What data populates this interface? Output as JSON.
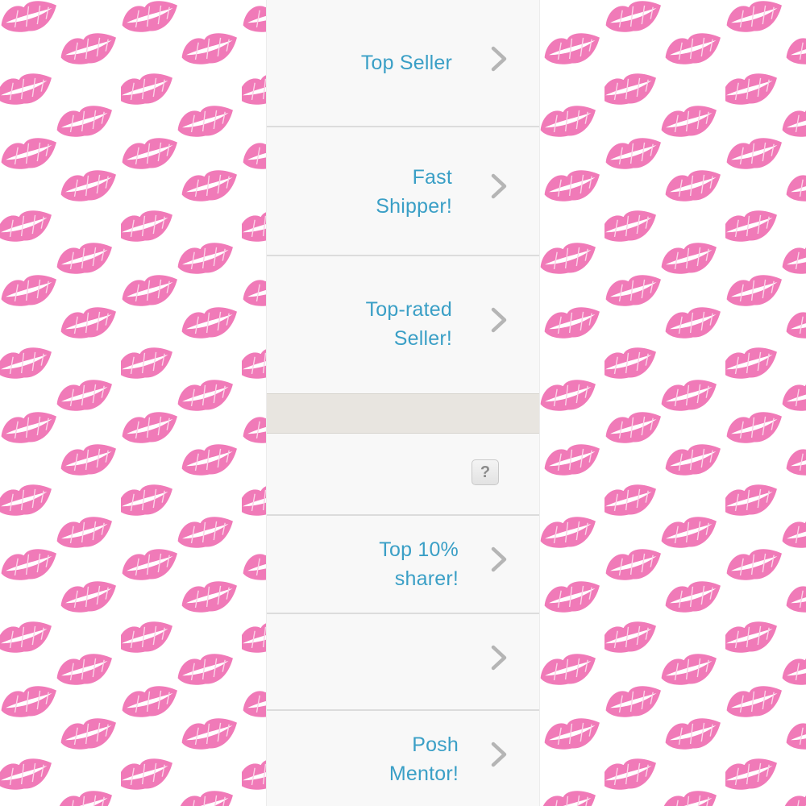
{
  "rows": [
    {
      "label": "Top Seller"
    },
    {
      "label": "Fast\nShipper!"
    },
    {
      "label": "Top-rated\nSeller!"
    },
    {
      "label": "Top 10%\nsharer!"
    },
    {
      "label": ""
    },
    {
      "label": "Posh\nMentor!"
    }
  ],
  "help_row": {
    "icon_text": "?"
  },
  "colors": {
    "link_text": "#3a9fc6",
    "lips": "#f07ab8",
    "chevron": "#b5b5b5"
  },
  "icons": {
    "chevron": "chevron-right-icon",
    "help": "help-icon",
    "background": "lips-icon"
  }
}
